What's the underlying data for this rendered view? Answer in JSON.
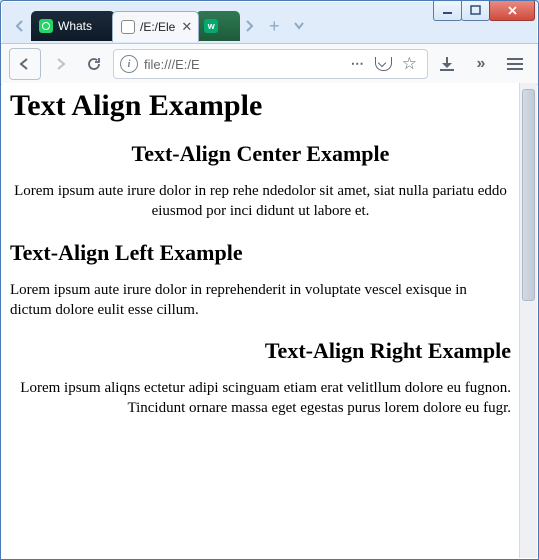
{
  "window": {
    "controls": {
      "minimize": "minimize",
      "maximize": "maximize",
      "close": "close"
    }
  },
  "tabs": {
    "prev": "‹",
    "items": [
      {
        "label": "Whats",
        "favicon": "whatsapp"
      },
      {
        "label": "/E:/Ele",
        "favicon": "file",
        "active": true
      },
      {
        "label": "",
        "favicon": "w3"
      }
    ],
    "next": "›",
    "newtab": "+"
  },
  "toolbar": {
    "back": "←",
    "forward": "→",
    "reload": "↻",
    "address_prefix": "file:///E:/E",
    "more": "⋯",
    "pocket": "pocket",
    "star": "☆",
    "download": "download",
    "overflow": "»",
    "menu": "menu"
  },
  "page": {
    "h1": "Text Align Example",
    "center": {
      "heading": "Text-Align Center Example",
      "body": "Lorem ipsum aute irure dolor in rep rehe ndedolor sit amet, siat nulla pariatu eddo eiusmod por inci didunt ut labore et."
    },
    "left": {
      "heading": "Text-Align Left Example",
      "body": "Lorem ipsum aute irure dolor in reprehenderit in voluptate vescel exisque in dictum dolore eulit esse cillum."
    },
    "right": {
      "heading": "Text-Align Right Example",
      "body": "Lorem ipsum aliqns ectetur adipi scinguam etiam erat velitllum dolore eu fugnon. Tincidunt ornare massa eget egestas purus lorem dolore eu fugr."
    }
  }
}
